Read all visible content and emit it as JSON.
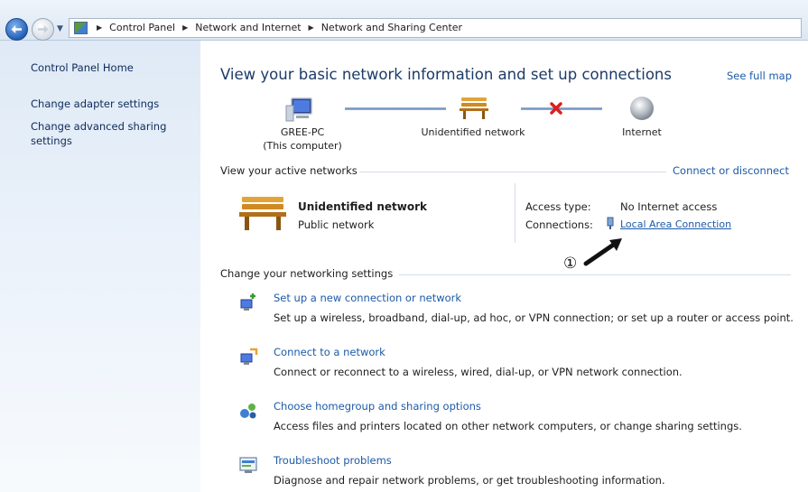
{
  "breadcrumb": {
    "items": [
      "Control Panel",
      "Network and Internet",
      "Network and Sharing Center"
    ]
  },
  "sidebar": {
    "items": [
      {
        "label": "Control Panel Home"
      },
      {
        "label": "Change adapter settings"
      },
      {
        "label": "Change advanced sharing settings"
      }
    ]
  },
  "main": {
    "title": "View your basic network information and set up connections",
    "see_full_map": "See full map",
    "map": {
      "computer_name": "GREE-PC",
      "computer_sub": "(This computer)",
      "network": "Unidentified network",
      "internet": "Internet"
    },
    "active_networks": {
      "heading": "View your active networks",
      "connect_link": "Connect or disconnect",
      "network_name": "Unidentified network",
      "network_type": "Public network",
      "access_type_label": "Access type:",
      "access_type_value": "No Internet access",
      "connections_label": "Connections:",
      "connections_value": "Local Area Connection"
    },
    "settings": {
      "heading": "Change your networking settings",
      "tasks": [
        {
          "link": "Set up a new connection or network",
          "desc": "Set up a wireless, broadband, dial-up, ad hoc, or VPN connection; or set up a router or access point."
        },
        {
          "link": "Connect to a network",
          "desc": "Connect or reconnect to a wireless, wired, dial-up, or VPN network connection."
        },
        {
          "link": "Choose homegroup and sharing options",
          "desc": "Access files and printers located on other network computers, or change sharing settings."
        },
        {
          "link": "Troubleshoot problems",
          "desc": "Diagnose and repair network problems, or get troubleshooting information."
        }
      ]
    }
  },
  "annotation": {
    "callout": "①"
  },
  "colors": {
    "link": "#1c5aa8",
    "title": "#1c3b67",
    "error_x": "#d9201f"
  },
  "icons": [
    "back-arrow-icon",
    "forward-arrow-icon",
    "control-panel-icon",
    "computer-icon",
    "bench-network-icon",
    "red-x-icon",
    "globe-icon",
    "network-adapter-icon",
    "arrow-pointer-icon"
  ]
}
